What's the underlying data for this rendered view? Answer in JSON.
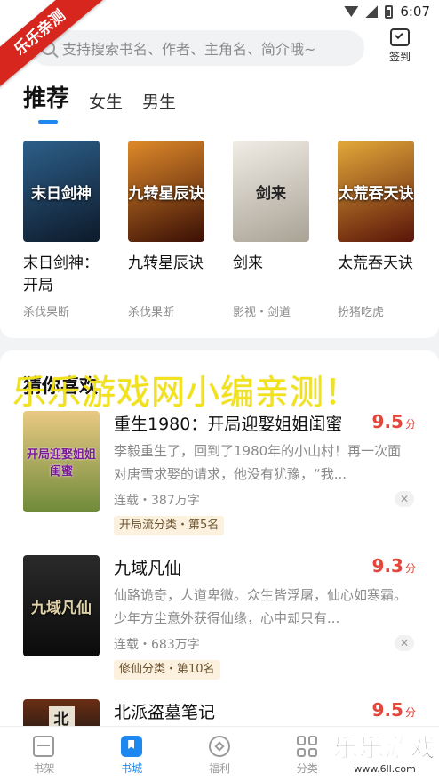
{
  "status_bar": {
    "time": "6:07"
  },
  "ribbon": {
    "text": "乐乐亲测"
  },
  "search": {
    "placeholder": "支持搜索书名、作者、主角名、简介哦~"
  },
  "signin": {
    "label": "签到"
  },
  "tabs": [
    {
      "label": "推荐",
      "active": true
    },
    {
      "label": "女生",
      "active": false
    },
    {
      "label": "男生",
      "active": false
    }
  ],
  "recommend": [
    {
      "title": "末日剑神：开局",
      "tag": "杀伐果断",
      "cover_text": "末日剑神",
      "cover_color": "#1c3b5a"
    },
    {
      "title": "九转星辰诀",
      "tag": "杀伐果断",
      "cover_text": "九转星辰诀",
      "cover_color": "#7a2a0e"
    },
    {
      "title": "剑来",
      "tag": "影视・剑道",
      "cover_text": "剑来",
      "cover_color": "#d9d5cc"
    },
    {
      "title": "太荒吞天诀",
      "tag": "扮猪吃虎",
      "cover_text": "太荒吞天诀",
      "cover_color": "#8a2a10"
    }
  ],
  "guess": {
    "title": "猜你喜欢"
  },
  "watermark": {
    "text": "乐乐游戏网小编亲测！"
  },
  "books": [
    {
      "title": "重生1980：开局迎娶姐姐闺蜜",
      "score": "9.5",
      "score_unit": "分",
      "desc": "李毅重生了，回到了1980年的小山村！再一次面对唐雪求娶的请求，他没有犹豫，“我...",
      "meta": "连载・387万字",
      "badge": "开局流分类・第5名",
      "cover_text": "开局迎娶姐姐闺蜜",
      "cover_color": "#c9a44a"
    },
    {
      "title": "九域凡仙",
      "score": "9.3",
      "score_unit": "分",
      "desc": "仙路诡奇，人道卑微。众生皆浮屠，仙心如寒霜。少年方尘意外获得仙缘，心中却只有...",
      "meta": "连载・683万字",
      "badge": "修仙分类・第10名",
      "cover_text": "九域凡仙",
      "cover_color": "#1a1a1a"
    },
    {
      "title": "北派盗墓笔记",
      "score": "9.5",
      "score_unit": "分",
      "cover_text": "北",
      "cover_color": "#2b1d14"
    }
  ],
  "tabbar": [
    {
      "label": "书架",
      "icon": "bookshelf-icon",
      "active": false
    },
    {
      "label": "书城",
      "icon": "bookstore-icon",
      "active": true
    },
    {
      "label": "福利",
      "icon": "welfare-icon",
      "active": false
    },
    {
      "label": "分类",
      "icon": "category-icon",
      "active": false
    }
  ],
  "corner_logo": {
    "text": "乐乐游戏",
    "url": "www.6ll.com"
  },
  "colors": {
    "accent": "#1e88f0",
    "score": "#e3463b",
    "watermark": "#f2e21c",
    "ribbon": "#d7261e"
  }
}
